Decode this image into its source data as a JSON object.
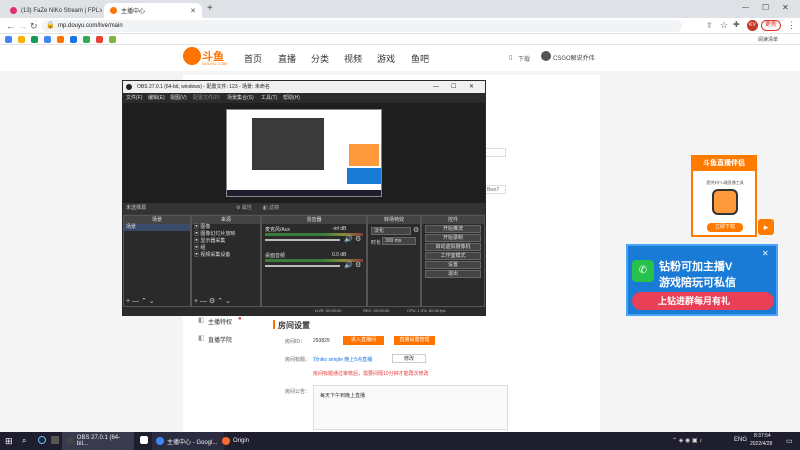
{
  "browser": {
    "tabs": [
      {
        "label": "(13) FaZe NiKo Stream | FPL",
        "icon_color": "#e1306c",
        "active": false
      },
      {
        "label": "主播中心",
        "icon_color": "#ff7300",
        "active": true
      }
    ],
    "new_tab": "+",
    "url": "mp.douyu.com/live/main",
    "update_label": "更新",
    "reading_list": "阅读清单",
    "avatar": "KV"
  },
  "site": {
    "logo_text": "斗鱼",
    "logo_sub": "DOUYU.COM",
    "nav": [
      "首页",
      "直播",
      "分类",
      "视频",
      "游戏",
      "鱼吧"
    ],
    "download": "下载",
    "user": "CSGO解说乔伟",
    "sidebar": [
      {
        "label": "主播特权",
        "dot": true
      },
      {
        "label": "直播学院",
        "dot": false
      }
    ],
    "room_settings": {
      "title": "房间设置",
      "room_id_label": "房间ID：",
      "room_id": "293829",
      "enter_btn": "进入直播间",
      "apply_btn": "直播设置管理",
      "title_label": "房间标题：",
      "title_value": "刘niko simple 晚上5点直播",
      "modify_btn": "修改",
      "warning": "房间标题通过审核后，需要间隔10分钟才能再次修改",
      "notice_label": "房间公告：",
      "notice_value": "每天下午到晚上直播"
    },
    "partial_field": "Bws7"
  },
  "obs": {
    "title": "OBS 27.0.1 (64-bit, windows) - 配置文件: 123 - 场景: 未命名",
    "menu": [
      "文件(F)",
      "编辑(E)",
      "视图(V)",
      "配置文件(P)",
      "场景集合(S)",
      "工具(T)",
      "帮助(H)"
    ],
    "no_source": "未选择源",
    "props_btn": "属性",
    "filter_btn": "滤镜",
    "docks": {
      "scenes": {
        "title": "场景",
        "items": [
          "场景"
        ]
      },
      "sources": {
        "title": "来源",
        "items": [
          "图像",
          "图像幻灯片放映",
          "显示器采集",
          "组",
          "视频采集设备"
        ]
      },
      "mixer": {
        "title": "混音器",
        "channels": [
          {
            "name": "麦克风/Aux",
            "level": "-inf dB"
          },
          {
            "name": "桌面音频",
            "level": "0.0 dB"
          }
        ]
      },
      "transitions": {
        "title": "转场特效",
        "type": "淡化",
        "duration_label": "时长",
        "duration": "300 ms"
      },
      "controls": {
        "title": "控件",
        "buttons": [
          "开始推流",
          "开始录制",
          "启动虚拟摄像机",
          "工作室模式",
          "设置",
          "退出"
        ]
      }
    },
    "status": {
      "live": "LIVE: 00:00:00",
      "rec": "REC: 00:00:00",
      "cpu": "CPU: 1.3%, 60.00 fps"
    }
  },
  "promos": {
    "card": {
      "title": "斗鱼直播伴侣",
      "sub": "提供对PC端直播工具",
      "btn": "立即下载"
    },
    "banner": {
      "line1": "钻粉可加主播V",
      "line2": "游戏陪玩可私信",
      "line3": "上钻进群每月有礼"
    }
  },
  "taskbar": {
    "items": [
      {
        "label": "OBS 27.0.1 (64-bit...",
        "icon_color": "#444"
      },
      {
        "label": "主播中心 - Googl...",
        "icon_color": "#4285f4"
      },
      {
        "label": "Origin",
        "icon_color": "#f56c2d"
      }
    ],
    "lang": "ENG",
    "time": "8:37:54",
    "date": "2022/4/28"
  }
}
